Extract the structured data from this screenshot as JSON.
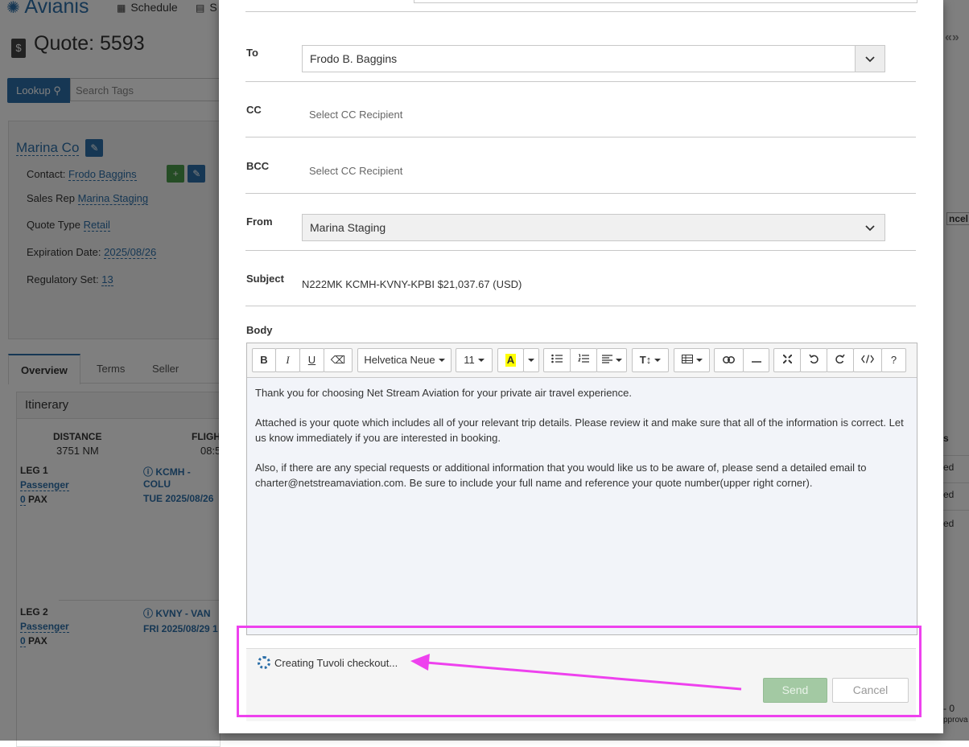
{
  "app": {
    "logo": "Avianis",
    "nav": [
      "Schedule",
      "S"
    ],
    "quote_title": "Quote: 5593",
    "lookup_label": "Lookup",
    "search_tags_placeholder": "Search Tags",
    "company": "Marina Co",
    "contact_label": "Contact:",
    "contact_value": "Frodo Baggins",
    "sales_rep_label": "Sales Rep",
    "sales_rep_value": "Marina Staging",
    "quote_type_label": "Quote Type",
    "quote_type_value": "Retail",
    "expiration_label": "Expiration Date:",
    "expiration_value": "2025/08/26",
    "regulatory_label": "Regulatory Set:",
    "regulatory_value": "13",
    "tabs": [
      "Overview",
      "Terms",
      "Seller Notes"
    ],
    "itinerary_title": "Itinerary",
    "distance_label": "DISTANCE",
    "distance_value": "3751 NM",
    "flight_label": "FLIGH",
    "flight_value": "08:5",
    "legs": [
      {
        "label": "LEG 1",
        "type": "Passenger",
        "pax_count": "0",
        "pax_label": "PAX",
        "route": "KCMH - COLU",
        "date": "TUE 2025/08/26"
      },
      {
        "label": "LEG 2",
        "type": "Passenger",
        "pax_count": "0",
        "pax_label": "PAX",
        "route": "KVNY - VAN",
        "date": "FRI 2025/08/29 1"
      }
    ],
    "right_strip": {
      "cancel_fragment": "ncel",
      "s_fragment": "s",
      "rows": [
        "ed",
        "ed",
        "ed"
      ],
      "bottom_fragment": "- 0",
      "approval_fragment": "pprova"
    }
  },
  "modal": {
    "to_label": "To",
    "to_value": "Frodo B. Baggins",
    "cc_label": "CC",
    "cc_placeholder": "Select CC Recipient",
    "bcc_label": "BCC",
    "bcc_placeholder": "Select CC Recipient",
    "from_label": "From",
    "from_value": "Marina Staging",
    "subject_label": "Subject",
    "subject_value": "N222MK KCMH-KVNY-KPBI $21,037.67 (USD)",
    "body_label": "Body",
    "toolbar": {
      "bold": "B",
      "italic": "I",
      "underline": "U",
      "eraser": "⌫",
      "font": "Helvetica Neue",
      "size": "11",
      "highlight": "A",
      "text_height": "T↕",
      "help": "?"
    },
    "body_paragraphs": [
      "Thank you for choosing Net Stream Aviation for your private air travel experience.",
      "Attached is your quote which includes all of your relevant trip details. Please review it and make sure that all of the information is correct. Let us know immediately if you are interested in booking.",
      "Also, if there are any special requests or additional information that you would like us to be aware of, please send a detailed email to charter@netstreamaviation.com. Be sure to include your full name and reference your quote number(upper right corner)."
    ],
    "status_text": "Creating Tuvoli checkout...",
    "send_label": "Send",
    "cancel_label": "Cancel"
  },
  "colors": {
    "brand": "#2c6fa8",
    "annotation": "#ee41ee",
    "send_disabled": "#a3c9a3"
  }
}
